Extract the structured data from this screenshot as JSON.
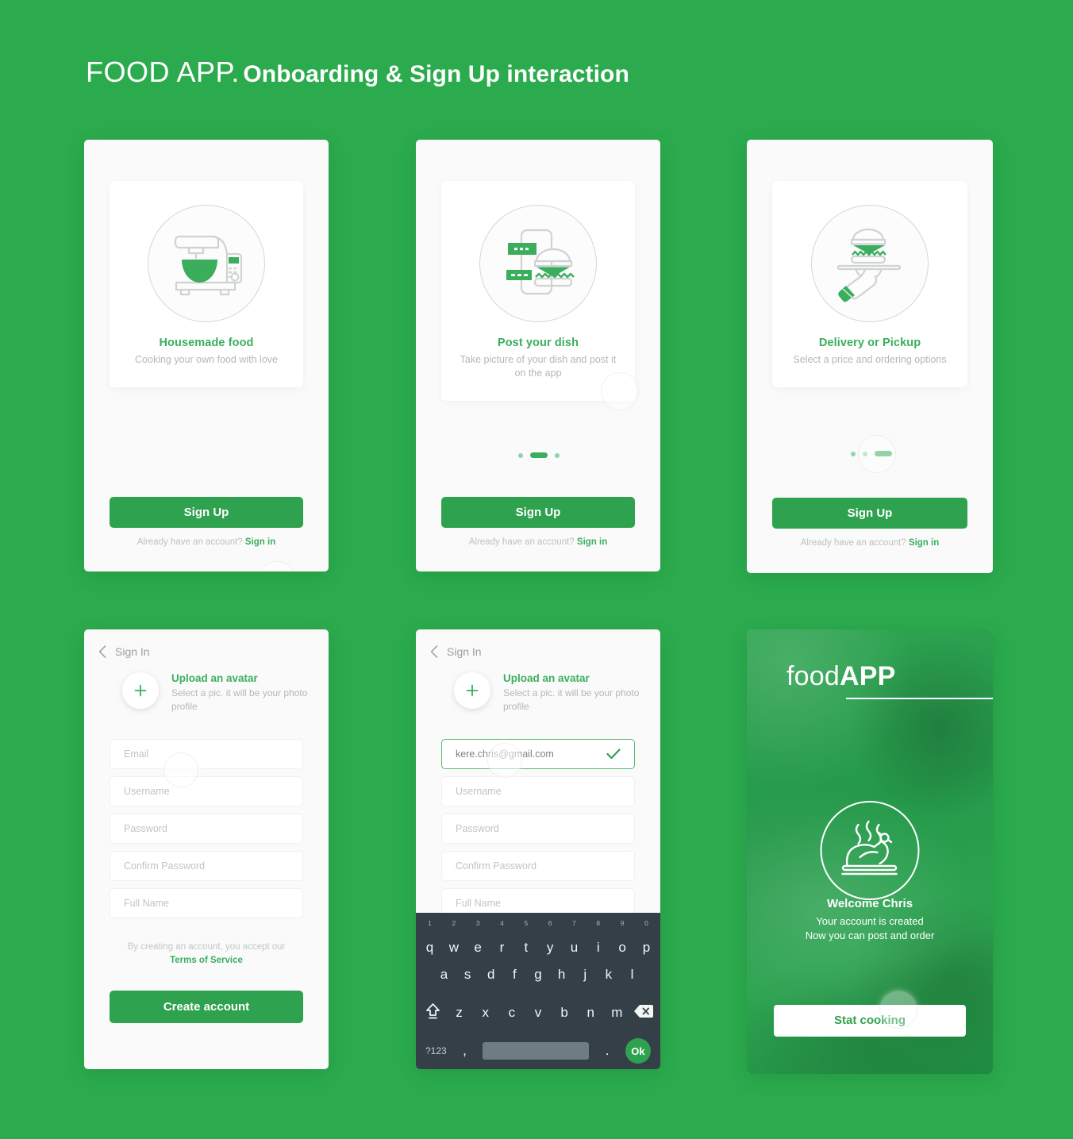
{
  "header": {
    "title_brand": "FOOD APP.",
    "title_rest": "Onboarding & Sign Up interaction"
  },
  "colors": {
    "background": "#2BAB4D",
    "accent_green": "#3BAE5E",
    "button_green": "#2FA24F",
    "muted_text": "#B3B9B5",
    "keyboard_bg": "#343F47"
  },
  "onboarding": {
    "cta_label": "Sign Up",
    "footer_text": "Already have an account? ",
    "footer_link": "Sign in",
    "slides": [
      {
        "title": "Housemade food",
        "subtitle": "Cooking your own food with love",
        "illustration": "stand-mixer-icon",
        "active_index": 0
      },
      {
        "title": "Post your dish",
        "subtitle": "Take picture of your dish and post it on the app",
        "illustration": "phone-burger-icon",
        "active_index": 1
      },
      {
        "title": "Delivery or Pickup",
        "subtitle": "Select a price and ordering options",
        "illustration": "hand-tray-burger-icon",
        "active_index": 2
      }
    ]
  },
  "signup": {
    "nav_back_label": "Sign In",
    "avatar_title": "Upload an avatar",
    "avatar_subtitle": "Select a pic. it will be your photo profile",
    "fields": {
      "email_placeholder": "Email",
      "email_value": "kere.chris@gmail.com",
      "username_placeholder": "Username",
      "password_placeholder": "Password",
      "confirm_password_placeholder": "Confirm Password",
      "fullname_placeholder": "Full Name"
    },
    "terms_text": "By creating an account, you accept our ",
    "terms_link": "Terms of Service",
    "submit_label": "Create account"
  },
  "keyboard": {
    "row1": [
      {
        "key": "q",
        "num": "1"
      },
      {
        "key": "w",
        "num": "2"
      },
      {
        "key": "e",
        "num": "3"
      },
      {
        "key": "r",
        "num": "4"
      },
      {
        "key": "t",
        "num": "5"
      },
      {
        "key": "y",
        "num": "6"
      },
      {
        "key": "u",
        "num": "7"
      },
      {
        "key": "i",
        "num": "8"
      },
      {
        "key": "o",
        "num": "9"
      },
      {
        "key": "p",
        "num": "0"
      }
    ],
    "row2": [
      "a",
      "s",
      "d",
      "f",
      "g",
      "h",
      "j",
      "k",
      "l"
    ],
    "row3": [
      "z",
      "x",
      "c",
      "v",
      "b",
      "n",
      "m"
    ],
    "symbols_label": "?123",
    "comma_label": ",",
    "period_label": ".",
    "ok_label": "Ok"
  },
  "welcome": {
    "logo_thin": "food",
    "logo_bold": "APP",
    "heading": "Welcome Chris",
    "line1": "Your account is created",
    "line2": "Now you can post and order",
    "cta_label": "Stat cooking",
    "illustration": "roast-chicken-icon"
  }
}
